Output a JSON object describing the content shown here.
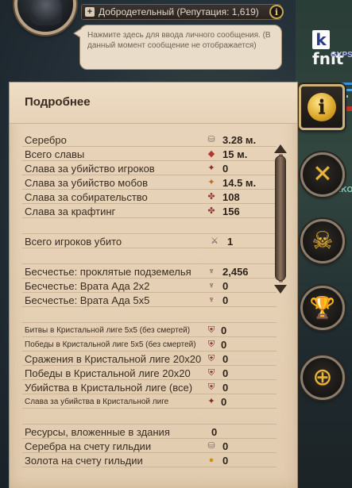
{
  "header": {
    "reputation_text": "Добродетельный (Репутация: 1,619)",
    "reputation_expand": "+",
    "reputation_info": "i",
    "message_hint": "Нажмите здесь для ввода личного сообщения. (В данный момент сообщение не отображается)"
  },
  "world": {
    "player_name": "fnit",
    "player_initial": "k",
    "guild": "GYPS",
    "player_name2": "fni",
    "guild2": "RKO"
  },
  "side_tabs": [
    {
      "name": "info",
      "glyph": "i"
    },
    {
      "name": "pvp",
      "glyph": "✕"
    },
    {
      "name": "pve",
      "glyph": "☠"
    },
    {
      "name": "achievements",
      "glyph": "🏆"
    },
    {
      "name": "guild",
      "glyph": "⊕"
    }
  ],
  "panel": {
    "title": "Подробнее",
    "stats": [
      {
        "label": "Серебро",
        "value": "3.28 м.",
        "icon": "silver-icon"
      },
      {
        "label": "Всего славы",
        "value": "15 м.",
        "icon": "fame-icon"
      },
      {
        "label": "Слава за убийство игроков",
        "value": "0",
        "icon": "pvp-fame-icon"
      },
      {
        "label": "Слава за убийство мобов",
        "value": "14.5 м.",
        "icon": "pve-fame-icon"
      },
      {
        "label": "Слава за собирательство",
        "value": "108",
        "icon": "gathering-fame-icon"
      },
      {
        "label": "Слава за крафтинг",
        "value": "156",
        "icon": "crafting-fame-icon"
      },
      {
        "label": "Всего игроков убито",
        "value": "1",
        "icon": "swords-icon"
      },
      {
        "label": "Бесчестье: проклятые подземелья",
        "value": "2,456",
        "icon": "infamy-icon"
      },
      {
        "label": "Бесчестье: Врата Ада 2x2",
        "value": "0",
        "icon": "infamy-icon"
      },
      {
        "label": "Бесчестье: Врата Ада 5x5",
        "value": "0",
        "icon": "infamy-icon"
      },
      {
        "label": "Битвы в Кристальной лиге 5x5 (без смертей)",
        "value": "0",
        "icon": "crystal-icon"
      },
      {
        "label": "Победы в Кристальной лиге 5x5 (без смертей)",
        "value": "0",
        "icon": "crystal-icon"
      },
      {
        "label": "Сражения в Кристальной лиге 20x20",
        "value": "0",
        "icon": "crystal-icon"
      },
      {
        "label": "Победы в Кристальной лиге 20x20",
        "value": "0",
        "icon": "crystal-icon"
      },
      {
        "label": "Убийства в Кристальной лиге (все)",
        "value": "0",
        "icon": "crystal-icon"
      },
      {
        "label": "Слава за убийства в Кристальной лиге",
        "value": "0",
        "icon": "crystal-fame-icon"
      },
      {
        "label": "Ресурсы, вложенные в здания",
        "value": "0",
        "icon": ""
      },
      {
        "label": "Серебра на счету гильдии",
        "value": "0",
        "icon": "silver-icon"
      },
      {
        "label": "Золота на счету гильдии",
        "value": "0",
        "icon": "gold-icon"
      }
    ]
  }
}
